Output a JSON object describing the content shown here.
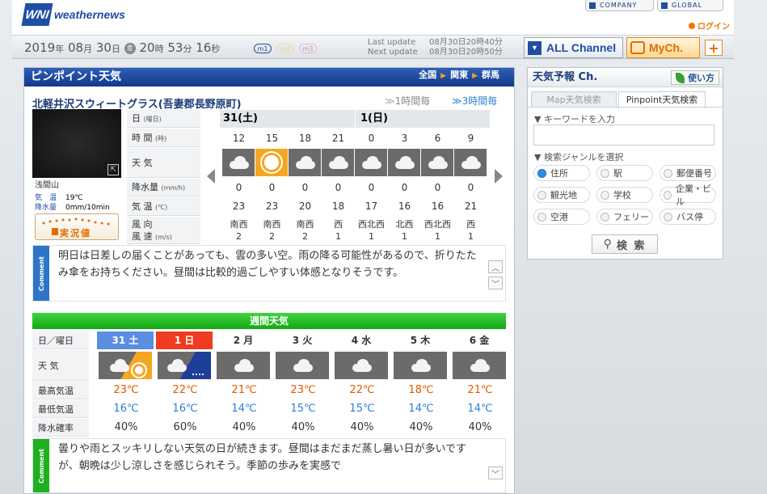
{
  "header": {
    "logo_mark": "WNI",
    "logo_text": "weathernews",
    "company": "COMPANY",
    "global": "GLOBAL",
    "login": "ログイン"
  },
  "datebar": {
    "year": "2019",
    "year_unit": "年",
    "month": "08",
    "month_unit": "月",
    "day": "30",
    "day_unit": "日",
    "weekday": "金",
    "hour": "20",
    "hour_unit": "時",
    "minute": "53",
    "minute_unit": "分",
    "second": "16",
    "second_unit": "秒",
    "m1": "m1",
    "m2": "m2",
    "m3": "m3",
    "last_update_label": "Last update",
    "last_update": "08月30日20時40分",
    "next_update_label": "Next update",
    "next_update": "08月30日20時50分",
    "all_channel": "ALL Channel",
    "mych": "MyCh.",
    "plus": "+"
  },
  "main": {
    "title": "ピンポイント天気",
    "crumbs": [
      "全国",
      "関東",
      "群馬"
    ],
    "location": "北軽井沢スウィートグラス(吾妻郡長野原町)",
    "toggle_1h": "1時間毎",
    "toggle_3h": "3時間毎",
    "camera": {
      "name": "浅間山",
      "temp_label": "気　温",
      "temp": "19℃",
      "rain_label": "降水量",
      "rain": "0mm/10min",
      "obs_button": "実況値"
    },
    "row_labels": {
      "day": "日",
      "day_unit": "(曜日)",
      "time": "時 間",
      "time_unit": "(時)",
      "weather": "天 気",
      "precip": "降水量",
      "precip_unit": "(mm/h)",
      "temp": "気 温",
      "temp_unit": "(℃)",
      "wind_dir": "風 向",
      "wind_speed": "風 速",
      "wind_unit": "(m/s)"
    },
    "day_headers": [
      "31(土)",
      "1(日)"
    ],
    "hours": [
      "12",
      "15",
      "18",
      "21",
      "0",
      "3",
      "6",
      "9"
    ],
    "weather": [
      "cloudy",
      "sunny",
      "cloudy",
      "cloudy",
      "cloudy",
      "cloudy",
      "cloudy",
      "cloudy"
    ],
    "precip": [
      "0",
      "0",
      "0",
      "0",
      "0",
      "0",
      "0",
      "0"
    ],
    "temps": [
      "23",
      "23",
      "20",
      "18",
      "17",
      "16",
      "16",
      "21"
    ],
    "wind_dirs": [
      "南西",
      "南西",
      "南西",
      "西",
      "西北西",
      "北西",
      "西北西",
      "西"
    ],
    "wind_speeds": [
      "2",
      "2",
      "2",
      "1",
      "1",
      "1",
      "1",
      "1"
    ],
    "comment_tab": "Comment",
    "comment": "明日は日差しの届くことがあっても、雲の多い空。雨の降る可能性があるので、折りたたみ傘をお持ちください。昼間は比較的過ごしやすい体感となりそうです。"
  },
  "weekly": {
    "title": "週間天気",
    "labels": {
      "day": "日／曜日",
      "weather": "天 気",
      "max": "最高気温",
      "min": "最低気温",
      "pop": "降水確率"
    },
    "days": [
      {
        "day": "31 土",
        "weather": "cloudy-then-sunny",
        "max": "23℃",
        "min": "16℃",
        "pop": "40%",
        "color": "#5b8de0"
      },
      {
        "day": "1 日",
        "weather": "cloudy-then-rain",
        "max": "22℃",
        "min": "16℃",
        "pop": "60%",
        "color": "#ef3b1f"
      },
      {
        "day": "2 月",
        "weather": "cloudy",
        "max": "21℃",
        "min": "14℃",
        "pop": "40%",
        "color": ""
      },
      {
        "day": "3 火",
        "weather": "cloudy",
        "max": "23℃",
        "min": "15℃",
        "pop": "40%",
        "color": ""
      },
      {
        "day": "4 水",
        "weather": "cloudy",
        "max": "22℃",
        "min": "15℃",
        "pop": "40%",
        "color": ""
      },
      {
        "day": "5 木",
        "weather": "cloudy",
        "max": "18℃",
        "min": "14℃",
        "pop": "40%",
        "color": ""
      },
      {
        "day": "6 金",
        "weather": "cloudy",
        "max": "21℃",
        "min": "14℃",
        "pop": "40%",
        "color": ""
      }
    ],
    "comment_tab": "Comment",
    "comment": "曇りや雨とスッキリしない天気の日が続きます。昼間はまだまだ蒸し暑い日が多いですが、朝晩は少し涼しさを感じられそう。季節の歩みを実感で"
  },
  "side": {
    "title": "天気予報 Ch.",
    "howto": "使い方",
    "tab_map": "Map天気検索",
    "tab_pinpoint": "Pinpoint天気検索",
    "keyword_head": "▼ キーワードを入力",
    "genre_head": "▼ 検索ジャンルを選択",
    "genres": [
      "住所",
      "駅",
      "郵便番号",
      "観光地",
      "学校",
      "企業・ビル",
      "空港",
      "フェリー",
      "バス停"
    ],
    "selected_genre": "住所",
    "search": "検 索"
  },
  "colors": {
    "navy": "#13388a",
    "green": "#13a813",
    "orange": "#e36c00",
    "max_temp": "#e35a00",
    "min_temp": "#2a7fd6"
  }
}
